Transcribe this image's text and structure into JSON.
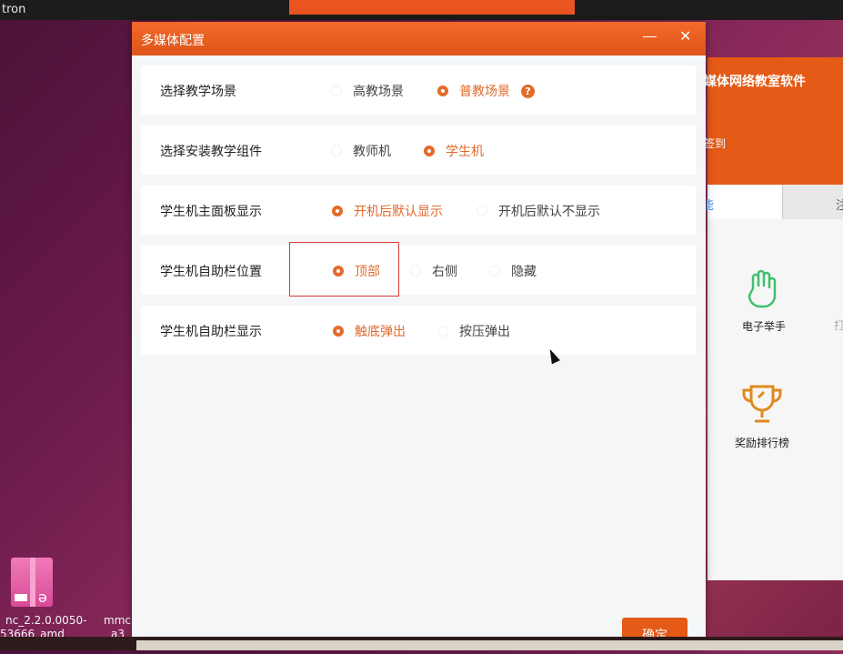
{
  "top_bar": {
    "title": "tron"
  },
  "desktop": {
    "icon_label_1": "nc_2.2.0.0050-",
    "icon_label_1b": "53666_amd",
    "icon_label_2": "mmc",
    "icon_label_2b": "a3"
  },
  "bg_app": {
    "title": "媒体网络教室软件",
    "signin": "签到",
    "tab_active": "能",
    "tab_2": "注",
    "features": [
      {
        "label": "电子举手",
        "icon": "raised-hand-icon"
      },
      {
        "label": "奖励排行榜",
        "icon": "trophy-icon"
      }
    ],
    "partial_label": "打"
  },
  "dialog": {
    "title": "多媒体配置",
    "rows": [
      {
        "label": "选择教学场景",
        "options": [
          {
            "text": "高教场景",
            "selected": false
          },
          {
            "text": "普教场景",
            "selected": true
          }
        ],
        "help": "?"
      },
      {
        "label": "选择安装教学组件",
        "options": [
          {
            "text": "教师机",
            "selected": false
          },
          {
            "text": "学生机",
            "selected": true
          }
        ]
      },
      {
        "label": "学生机主面板显示",
        "options": [
          {
            "text": "开机后默认显示",
            "selected": true
          },
          {
            "text": "开机后默认不显示",
            "selected": false
          }
        ]
      },
      {
        "label": "学生机自助栏位置",
        "options": [
          {
            "text": "顶部",
            "selected": true
          },
          {
            "text": "右侧",
            "selected": false
          },
          {
            "text": "隐藏",
            "selected": false
          }
        ]
      },
      {
        "label": "学生机自助栏显示",
        "options": [
          {
            "text": "触底弹出",
            "selected": true
          },
          {
            "text": "按压弹出",
            "selected": false
          }
        ]
      }
    ],
    "ok_label": "确定"
  },
  "colors": {
    "accent": "#e45a16",
    "selected_text": "#e06a2c",
    "highlight": "#e03a3a"
  }
}
